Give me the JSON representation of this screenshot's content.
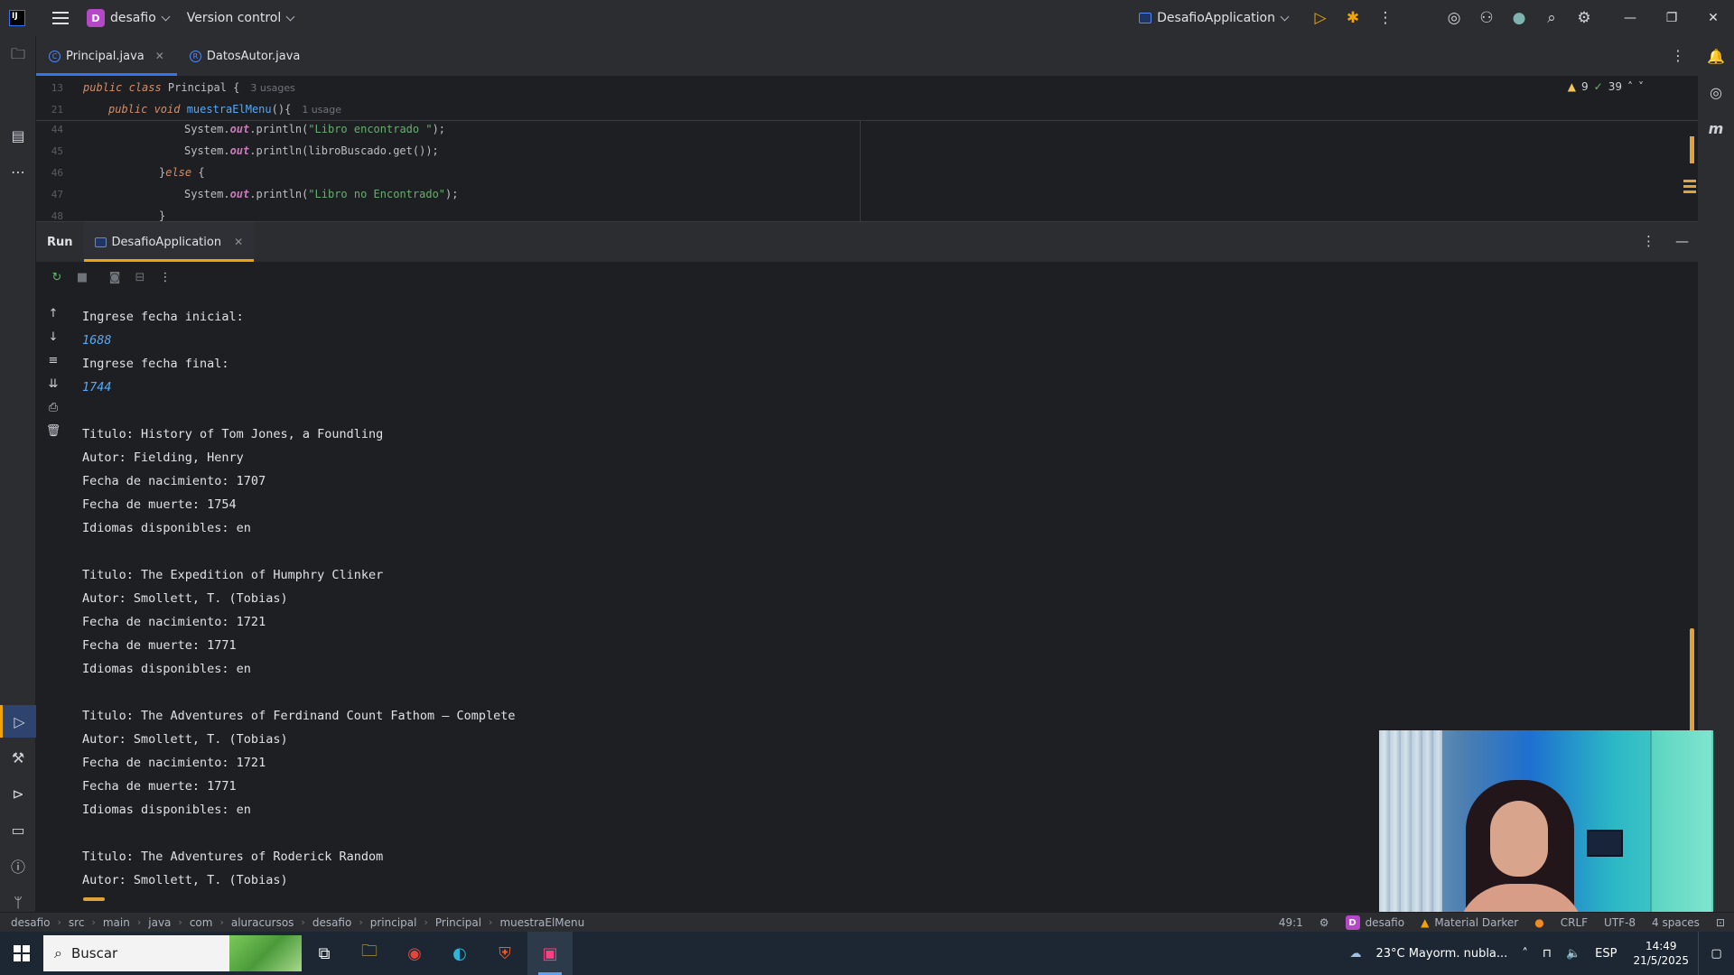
{
  "titlebar": {
    "project_badge": "D",
    "project_name": "desafio",
    "vcs_label": "Version control",
    "run_config": "DesafioApplication"
  },
  "editor_tabs": [
    {
      "label": "Principal.java",
      "active": true
    },
    {
      "label": "DatosAutor.java",
      "active": false
    }
  ],
  "editor": {
    "sticky": [
      {
        "num": "13",
        "code": "public class Principal {",
        "hint": "3 usages"
      },
      {
        "num": "21",
        "code": "public void muestraElMenu(){",
        "hint": "1 usage"
      }
    ],
    "lines": [
      {
        "num": "44",
        "code": "System.out.println(\"Libro encontrado \");"
      },
      {
        "num": "45",
        "code": "System.out.println(libroBuscado.get());"
      },
      {
        "num": "46",
        "code": "}else {"
      },
      {
        "num": "47",
        "code": "System.out.println(\"Libro no Encontrado\");"
      },
      {
        "num": "48",
        "code": "}"
      }
    ],
    "warnings": "9",
    "checks": "39"
  },
  "run": {
    "title": "Run",
    "tab": "DesafioApplication",
    "console": [
      {
        "text": "Ingrese fecha inicial:",
        "type": "out"
      },
      {
        "text": "1688",
        "type": "input"
      },
      {
        "text": "Ingrese fecha final:",
        "type": "out"
      },
      {
        "text": "1744",
        "type": "input"
      },
      {
        "text": "",
        "type": "out"
      },
      {
        "text": "Titulo: History of Tom Jones, a Foundling",
        "type": "out"
      },
      {
        "text": "Autor: Fielding, Henry",
        "type": "out"
      },
      {
        "text": "Fecha de nacimiento: 1707",
        "type": "out"
      },
      {
        "text": "Fecha de muerte: 1754",
        "type": "out"
      },
      {
        "text": "Idiomas disponibles: en",
        "type": "out"
      },
      {
        "text": "",
        "type": "out"
      },
      {
        "text": "Titulo: The Expedition of Humphry Clinker",
        "type": "out"
      },
      {
        "text": "Autor: Smollett, T. (Tobias)",
        "type": "out"
      },
      {
        "text": "Fecha de nacimiento: 1721",
        "type": "out"
      },
      {
        "text": "Fecha de muerte: 1771",
        "type": "out"
      },
      {
        "text": "Idiomas disponibles: en",
        "type": "out"
      },
      {
        "text": "",
        "type": "out"
      },
      {
        "text": "Titulo: The Adventures of Ferdinand Count Fathom — Complete",
        "type": "out"
      },
      {
        "text": "Autor: Smollett, T. (Tobias)",
        "type": "out"
      },
      {
        "text": "Fecha de nacimiento: 1721",
        "type": "out"
      },
      {
        "text": "Fecha de muerte: 1771",
        "type": "out"
      },
      {
        "text": "Idiomas disponibles: en",
        "type": "out"
      },
      {
        "text": "",
        "type": "out"
      },
      {
        "text": "Titulo: The Adventures of Roderick Random",
        "type": "out"
      },
      {
        "text": "Autor: Smollett, T. (Tobias)",
        "type": "out"
      }
    ]
  },
  "statusbar": {
    "breadcrumbs": [
      "desafio",
      "src",
      "main",
      "java",
      "com",
      "aluracursos",
      "desafio",
      "principal",
      "Principal",
      "muestraElMenu"
    ],
    "position": "49:1",
    "project_badge": "D",
    "project": "desafio",
    "theme": "Material Darker",
    "line_sep": "CRLF",
    "encoding": "UTF-8",
    "indent": "4 spaces"
  },
  "taskbar": {
    "search_placeholder": "Buscar",
    "weather": "23°C  Mayorm. nubla...",
    "lang": "ESP",
    "time": "14:49",
    "date": "21/5/2025"
  },
  "colors": {
    "accent": "#3574f0",
    "run_accent": "#f0a30a",
    "console_input": "#56a8f5"
  }
}
